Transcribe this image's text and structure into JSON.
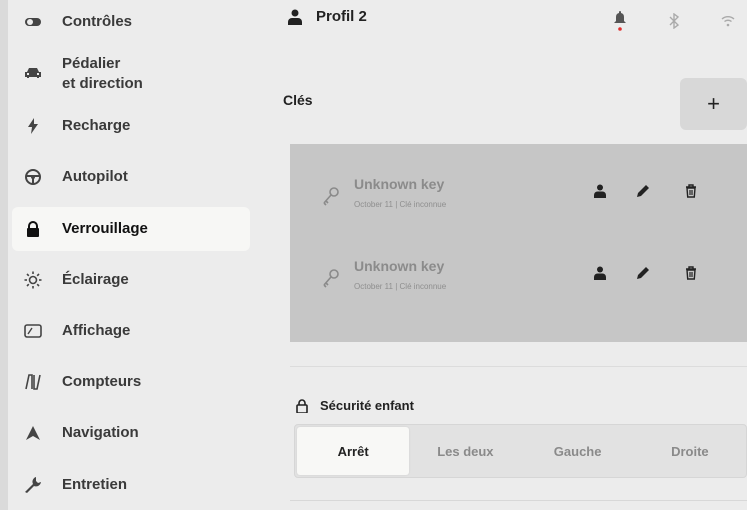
{
  "sidebar": {
    "items": [
      {
        "label": "Contrôles",
        "icon": "toggle-icon"
      },
      {
        "label": "Pédalier",
        "label2": "et direction",
        "icon": "car-icon"
      },
      {
        "label": "Recharge",
        "icon": "lightning-icon"
      },
      {
        "label": "Autopilot",
        "icon": "steering-wheel-icon"
      },
      {
        "label": "Verrouillage",
        "icon": "lock-icon",
        "active": true
      },
      {
        "label": "Éclairage",
        "icon": "sun-icon"
      },
      {
        "label": "Affichage",
        "icon": "display-icon"
      },
      {
        "label": "Compteurs",
        "icon": "road-icon"
      },
      {
        "label": "Navigation",
        "icon": "navigation-icon"
      },
      {
        "label": "Entretien",
        "icon": "wrench-icon"
      }
    ]
  },
  "topbar": {
    "profile_label": "Profil 2",
    "status_icons": [
      "bell-icon",
      "bluetooth-icon",
      "wifi-icon"
    ]
  },
  "keys": {
    "title": "Clés",
    "add_label": "+",
    "items": [
      {
        "name": "Unknown key",
        "subtitle": "October 11 | Clé inconnue"
      },
      {
        "name": "Unknown key",
        "subtitle": "October 11 | Clé inconnue"
      }
    ]
  },
  "child_safety": {
    "title": "Sécurité enfant",
    "options": [
      "Arrêt",
      "Les deux",
      "Gauche",
      "Droite"
    ],
    "selected": "Arrêt"
  },
  "colors": {
    "background": "#ececec",
    "keys_panel": "#c6c6c6",
    "active_item": "#f7f7f5",
    "notification_dot": "#e03030"
  }
}
